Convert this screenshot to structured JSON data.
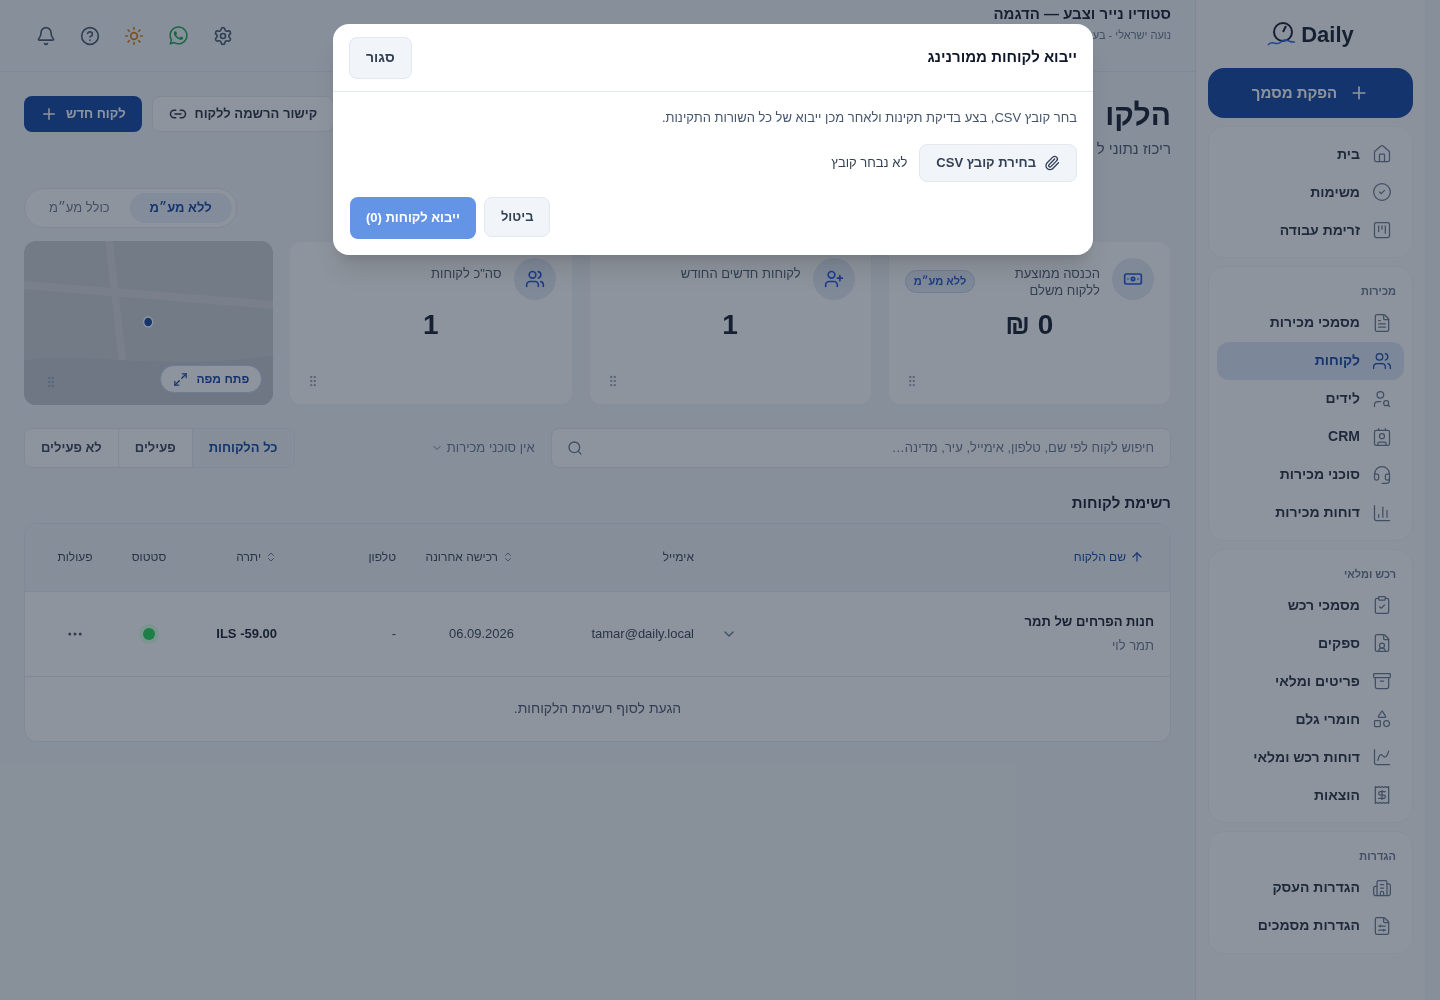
{
  "sidebar": {
    "logo": "Daily",
    "action_button": "הפקת מסמך",
    "groups": [
      {
        "items": [
          {
            "label": "בית",
            "selected": false
          },
          {
            "label": "משימות",
            "selected": false
          },
          {
            "label": "זרימת עבודה",
            "selected": false
          }
        ]
      },
      {
        "title": "מכירות",
        "items": [
          {
            "label": "מסמכי מכירות",
            "selected": false
          },
          {
            "label": "לקוחות",
            "selected": true
          },
          {
            "label": "לידים",
            "selected": false
          },
          {
            "label": "CRM",
            "selected": false
          },
          {
            "label": "סוכני מכירות",
            "selected": false
          },
          {
            "label": "דוחות מכירות",
            "selected": false
          }
        ]
      },
      {
        "title": "רכש ומלאי",
        "items": [
          {
            "label": "מסמכי רכש",
            "selected": false
          },
          {
            "label": "ספקים",
            "selected": false
          },
          {
            "label": "פריטים ומלאי",
            "selected": false
          },
          {
            "label": "חומרי גלם",
            "selected": false
          },
          {
            "label": "דוחות רכש ומלאי",
            "selected": false
          },
          {
            "label": "הוצאות",
            "selected": false
          }
        ]
      },
      {
        "title": "הגדרות",
        "items": [
          {
            "label": "הגדרות העסק",
            "selected": false
          },
          {
            "label": "הגדרות מסמכים",
            "selected": false
          }
        ]
      }
    ]
  },
  "header": {
    "business": "סטודיו נייר וצבע — הדגמה",
    "user": "נועה ישראלי - בע"
  },
  "page": {
    "title": "הלקו",
    "subtitle": "ריכוז נתוני ל",
    "buttons": [
      {
        "label": "קישור הרשמה ללקוח",
        "kind": "link"
      },
      {
        "label": "לקוח חדש",
        "kind": "primary"
      }
    ],
    "vat_toggle": [
      {
        "label": "ללא מע״מ",
        "selected": true
      },
      {
        "label": "כולל מע״מ",
        "selected": false
      }
    ]
  },
  "stats": [
    {
      "title": "הכנסה ממוצעת ללקוח משלם",
      "badge": "ללא מע״מ",
      "value": "0 ₪"
    },
    {
      "title": "לקוחות חדשים החודש",
      "value": "1"
    },
    {
      "title": "סה\"כ לקוחות",
      "value": "1"
    }
  ],
  "map": {
    "button": "פתח מפה"
  },
  "filters": {
    "search": {
      "placeholder": "חיפוש לקוח לפי שם, טלפון, אימייל, עיר, מדינה…"
    },
    "agents": "אין סוכני מכירות",
    "tabs": [
      {
        "label": "כל הלקוחות",
        "selected": true
      },
      {
        "label": "פעילים",
        "selected": false
      },
      {
        "label": "לא פעילים",
        "selected": false
      }
    ]
  },
  "table": {
    "title": "רשימת לקוחות",
    "columns": [
      {
        "label": "שם הלקוח",
        "sortable": true,
        "sorted": true
      },
      {
        "label": "אימייל",
        "sortable": false,
        "sorted": false
      },
      {
        "label": "רכישה אחרונה",
        "sortable": true,
        "sorted": false
      },
      {
        "label": "טלפון",
        "sortable": false,
        "sorted": false
      },
      {
        "label": "יתרה",
        "sortable": true,
        "sorted": false
      },
      {
        "label": "סטטוס",
        "sortable": false,
        "sorted": false
      },
      {
        "label": "פעולות",
        "sortable": false,
        "sorted": false
      }
    ],
    "rows": [
      {
        "name": "חנות הפרחים של תמר",
        "contact": "תמר לוי",
        "expanded": false,
        "email": "tamar@daily.local",
        "last_purchase": "06.09.2026",
        "phone": "-",
        "balance": "ILS -59.00",
        "color": "#1d7f46"
      }
    ],
    "footer": "הגעת לסוף רשימת הלקוחות."
  },
  "modal": {
    "title": "ייבוא לקוחות ממורנינג",
    "close": "סגור",
    "description": "בחר קובץ CSV, בצע בדיקת תקינות ולאחר מכן ייבוא של כל השורות התקינות.",
    "file_button": "בחירת קובץ CSV",
    "file_status": "לא נבחר קובץ",
    "buttons": [
      {
        "label": "ביטול",
        "kind": "secondary",
        "disabled": false
      },
      {
        "label": "ייבוא לקוחות (0)",
        "kind": "primary",
        "disabled": true
      }
    ]
  }
}
